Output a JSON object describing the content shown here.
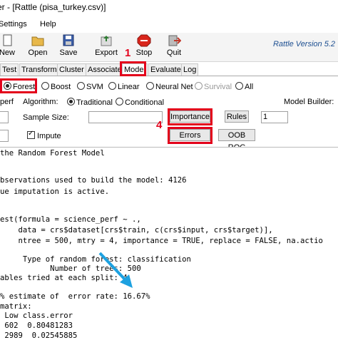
{
  "window": {
    "title": "er - [Rattle (pisa_turkey.csv)]"
  },
  "menu": {
    "settings": "Settings",
    "help": "Help"
  },
  "toolbar": {
    "new": "New",
    "open": "Open",
    "save": "Save",
    "export": "Export",
    "stop": "Stop",
    "quit": "Quit",
    "version": "Rattle Version 5.2"
  },
  "tabs": [
    "Test",
    "Transform",
    "Cluster",
    "Associate",
    "Model",
    "Evaluate",
    "Log"
  ],
  "annotations": {
    "one": "1",
    "four": "4"
  },
  "model_types": {
    "forest": "Forest",
    "boost": "Boost",
    "svm": "SVM",
    "linear": "Linear",
    "neural": "Neural Net",
    "survival": "Survival",
    "all": "All"
  },
  "algo": {
    "target": "perf",
    "algorithm_label": "Algorithm:",
    "traditional": "Traditional",
    "conditional": "Conditional",
    "builder_label": "Model Builder:"
  },
  "params": {
    "sample_label": "Sample Size:",
    "importance": "Importance",
    "rules": "Rules",
    "rules_value": "1",
    "impute": "Impute",
    "errors": "Errors",
    "oob": "OOB ROC"
  },
  "output": [
    "the Random Forest Model",
    "",
    "bservations used to build the model: 4126",
    "ue imputation is active.",
    "",
    "",
    "est(formula = science_perf ~ .,",
    "    data = crs$dataset[crs$train, c(crs$input, crs$target)],",
    "    ntree = 500, mtry = 4, importance = TRUE, replace = FALSE, na.actio",
    "",
    "     Type of random forest: classification",
    "           Number of trees: 500",
    "ables tried at each split: 4",
    "",
    "% estimate of  error rate: 16.67%",
    "matrix:",
    " Low class.error",
    " 602  0.80481283",
    " 2989  0.02545885"
  ]
}
